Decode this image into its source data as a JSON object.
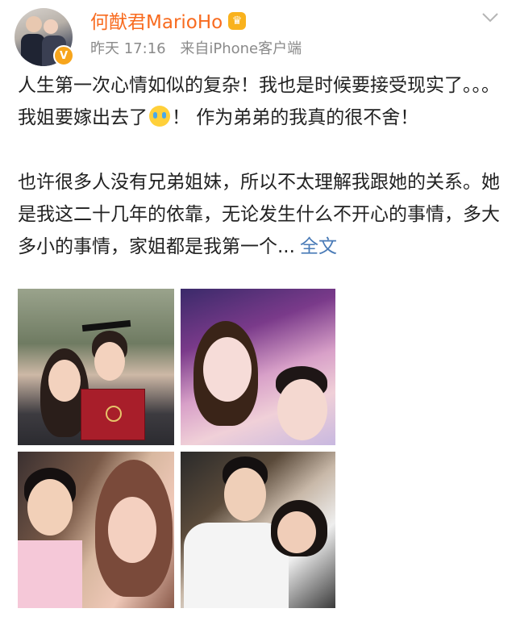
{
  "post": {
    "username": "何猷君MarioHo",
    "time": "昨天 17:16",
    "source": "来自iPhone客户端",
    "paragraph1_part1": "人生第一次心情如似的复杂！我也是时候要接受现实了。。。我姐要嫁出去了",
    "paragraph1_part2": "！ 作为弟弟的我真的很不舍！",
    "paragraph2": "也许很多人没有兄弟姐妹，所以不太理解我跟她的关系。她是我这二十几年的依靠，无论发生什么不开心的事情，多大多小的事情，家姐都是我第一个...",
    "full_text_link": "全文"
  },
  "icons": {
    "verified": "verified-v-icon",
    "badge": "crown-badge-icon",
    "chevron": "chevron-down-icon",
    "emoji": "crying-face-emoji-icon"
  },
  "colors": {
    "username": "#f86b1f",
    "meta": "#8a8a8a",
    "link": "#4a7bb7",
    "verified": "#f7a51c"
  },
  "photos": [
    {
      "alt": "graduation photo"
    },
    {
      "alt": "selfie at concert"
    },
    {
      "alt": "throwback photo"
    },
    {
      "alt": "photo in jersey"
    }
  ]
}
